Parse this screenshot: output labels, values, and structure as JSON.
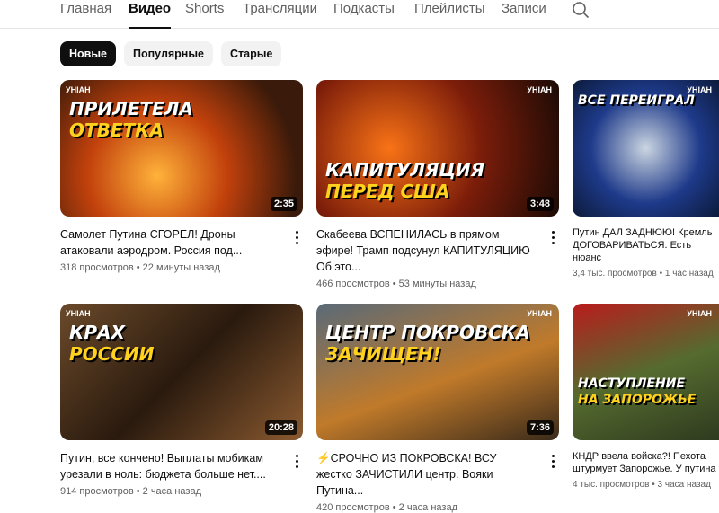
{
  "tabs": [
    "Главная",
    "Видео",
    "Shorts",
    "Трансляции",
    "Подкасты",
    "Плейлисты",
    "Записи"
  ],
  "active_tab": "Видео",
  "chips": [
    "Новые",
    "Популярные",
    "Старые"
  ],
  "videos": [
    {
      "title": "Самолет Путина СГОРЕЛ! Дроны атаковали аэродром. Россия под...",
      "views": "318 просмотров",
      "age": "22 минуты назад",
      "duration": "2:35",
      "thumb_line1": "ПРИЛЕТЕЛА",
      "thumb_line2": "ОТВЕТКА"
    },
    {
      "title": "Скабеева ВСПЕНИЛАСЬ в прямом эфире! Трамп подсунул КАПИТУЛЯЦИЮ Об это...",
      "views": "466 просмотров",
      "age": "53 минуты назад",
      "duration": "3:48",
      "thumb_line1": "КАПИТУЛЯЦИЯ",
      "thumb_line2": "ПЕРЕД США"
    },
    {
      "title": "Путин ДАЛ ЗАДНЮЮ! Кремль ДОГОВАРИВАТЬСЯ. Есть нюанс",
      "views": "3,4 тыс. просмотров",
      "age": "1 час назад",
      "duration": "",
      "thumb_line1": "ВСЕ ПЕРЕИГРАЛ",
      "thumb_line2": ""
    },
    {
      "title": "Путин, все кончено! Выплаты мобикам урезали в ноль: бюджета больше нет....",
      "views": "914 просмотров",
      "age": "2 часа назад",
      "duration": "20:28",
      "thumb_line1": "КРАХ",
      "thumb_line2": "РОССИИ"
    },
    {
      "title": "⚡СРОЧНО ИЗ ПОКРОВСКА! ВСУ жестко ЗАЧИСТИЛИ центр. Вояки Путина...",
      "views": "420 просмотров",
      "age": "2 часа назад",
      "duration": "7:36",
      "thumb_line1": "ЦЕНТР ПОКРОВСКА",
      "thumb_line2": "ЗАЧИЩЕН!"
    },
    {
      "title": "КНДР ввела войска?! Пехота штурмует Запорожье. У путина",
      "views": "4 тыс. просмотров",
      "age": "3 часа назад",
      "duration": "",
      "thumb_line1": "НАСТУПЛЕНИЕ",
      "thumb_line2": "НА ЗАПОРОЖЬЕ"
    }
  ],
  "channel_logo": "УНІАН",
  "separator": "•"
}
